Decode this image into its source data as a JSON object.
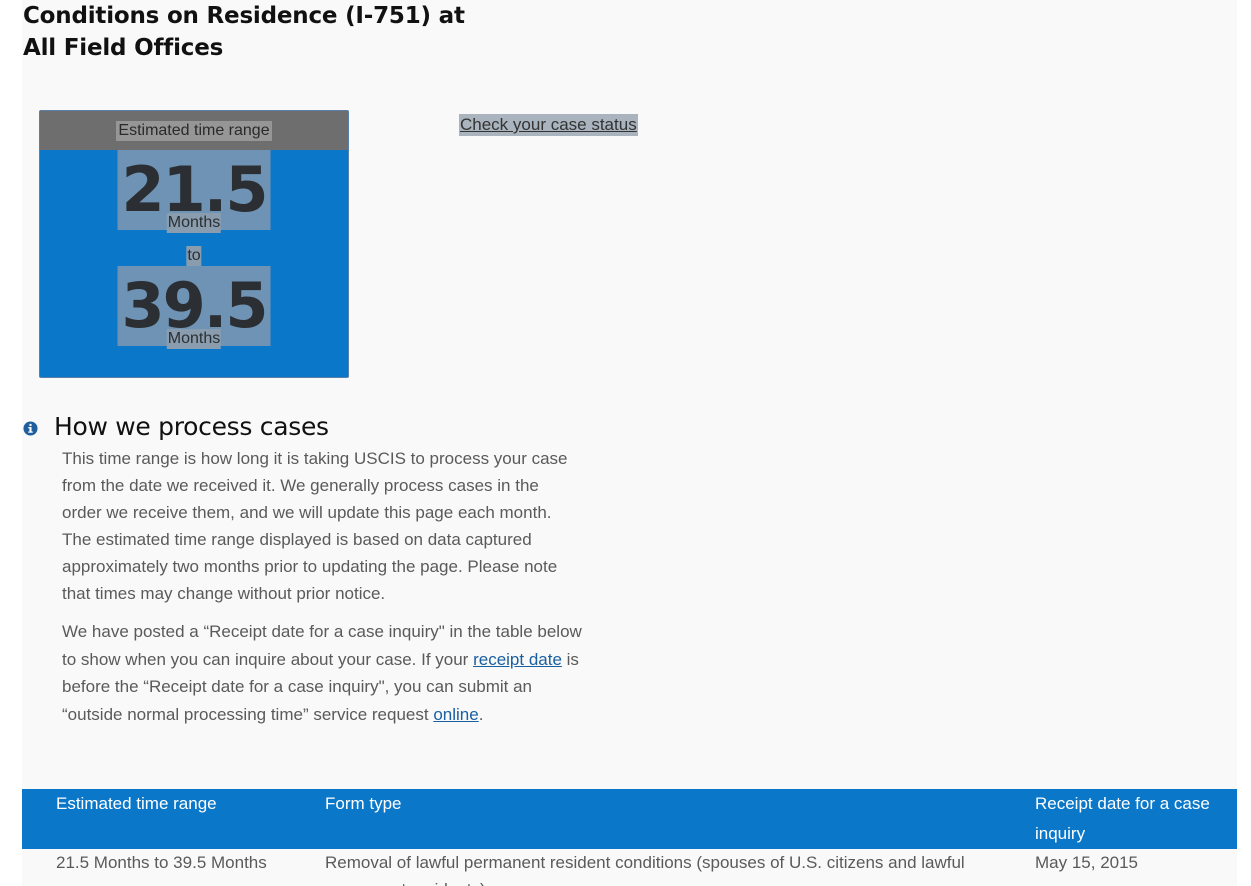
{
  "page": {
    "title": "Conditions on Residence (I-751) at All Field Offices"
  },
  "estimate": {
    "header": "Estimated time range",
    "from_value": "21.5",
    "from_unit": "Months",
    "separator": "to",
    "to_value": "39.5",
    "to_unit": "Months"
  },
  "links": {
    "check_status": "Check your case status"
  },
  "process": {
    "icon": "info-icon",
    "heading": "How we process cases",
    "paragraph1": "This time range is how long it is taking USCIS to process your case from the date we received it. We generally process cases in the order we receive them, and we will update this page each month. The estimated time range displayed is based on data captured approximately two months prior to updating the page. Please note that times may change without prior notice.",
    "paragraph2_a": "We have posted a “Receipt date for a case inquiry\" in the table below to show when you can inquire about your case. If your ",
    "paragraph2_link1": "receipt date",
    "paragraph2_b": " is before the “Receipt date for a case inquiry\", you can submit an “outside normal processing time” service request ",
    "paragraph2_link2": "online",
    "paragraph2_c": "."
  },
  "table": {
    "columns": [
      "Estimated time range",
      "Form type",
      "Receipt date for a case inquiry"
    ],
    "rows": [
      {
        "range": "21.5 Months to 39.5 Months",
        "form_type": "Removal of lawful permanent resident conditions (spouses of U.S. citizens and lawful permanent residents)",
        "receipt_date": "May 15, 2015"
      }
    ]
  },
  "colors": {
    "accent_blue": "#0b77c8",
    "header_gray": "#6e6e6e",
    "link_blue": "#1a5fa0"
  }
}
